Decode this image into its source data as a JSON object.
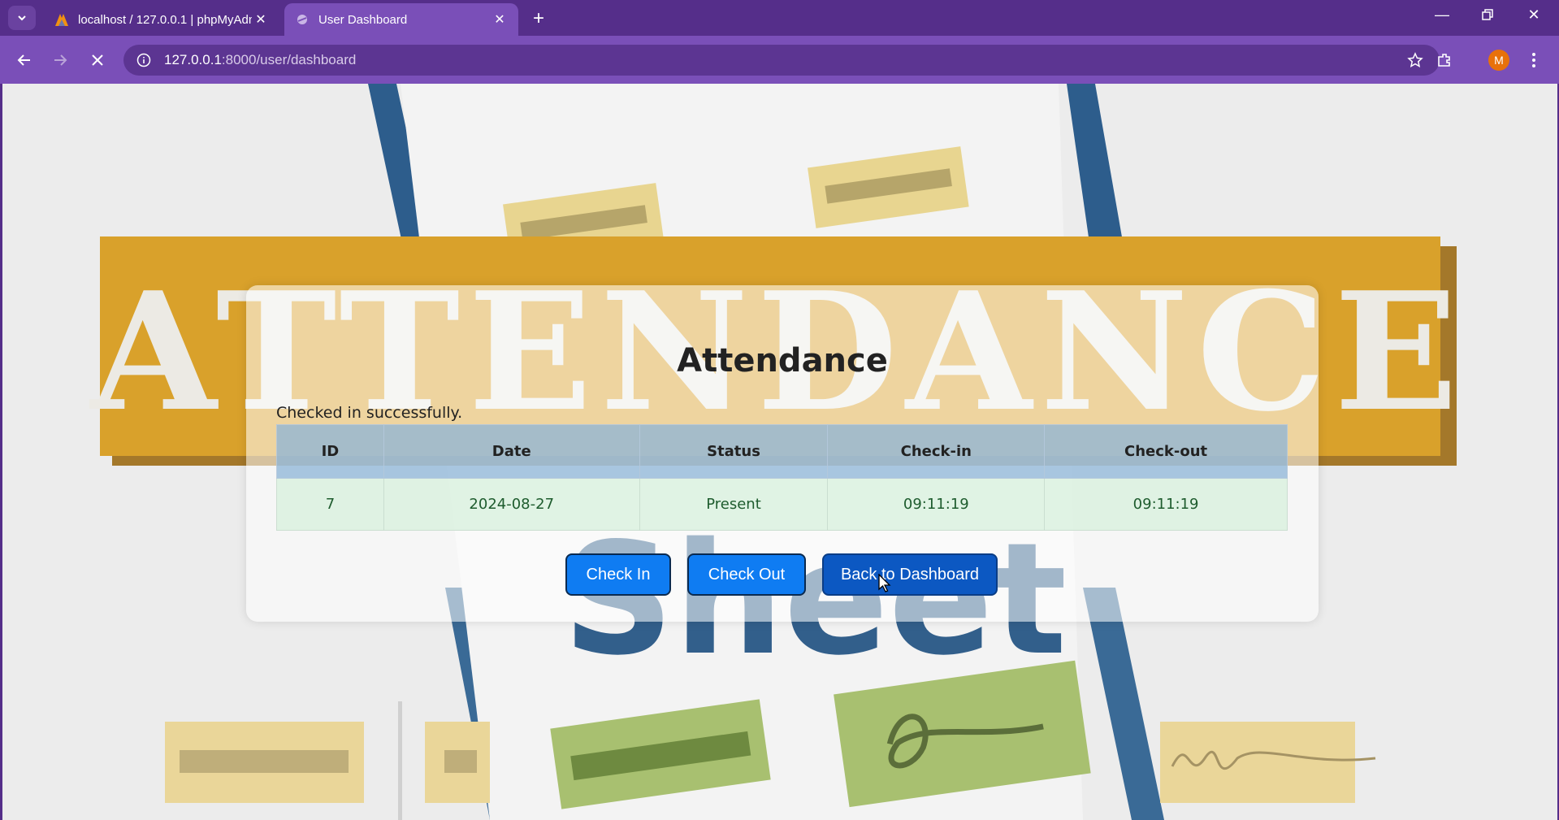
{
  "browser": {
    "tabs": [
      {
        "title": "localhost / 127.0.0.1 | phpMyAdmin",
        "active": false
      },
      {
        "title": "User Dashboard",
        "active": true
      }
    ],
    "url_host": "127.0.0.1",
    "url_path": ":8000/user/dashboard",
    "profile_initial": "M"
  },
  "page": {
    "title": "Attendance",
    "message": "Checked in successfully.",
    "table": {
      "headers": [
        "ID",
        "Date",
        "Status",
        "Check-in",
        "Check-out"
      ],
      "rows": [
        {
          "id": "7",
          "date": "2024-08-27",
          "status": "Present",
          "check_in": "09:11:19",
          "check_out": "09:11:19"
        }
      ]
    },
    "buttons": {
      "check_in": "Check In",
      "check_out": "Check Out",
      "back": "Back to Dashboard"
    }
  },
  "colors": {
    "browser_frame": "#552e8a",
    "primary_button": "#0f7cf2",
    "banner_gold": "#d9a12b"
  }
}
